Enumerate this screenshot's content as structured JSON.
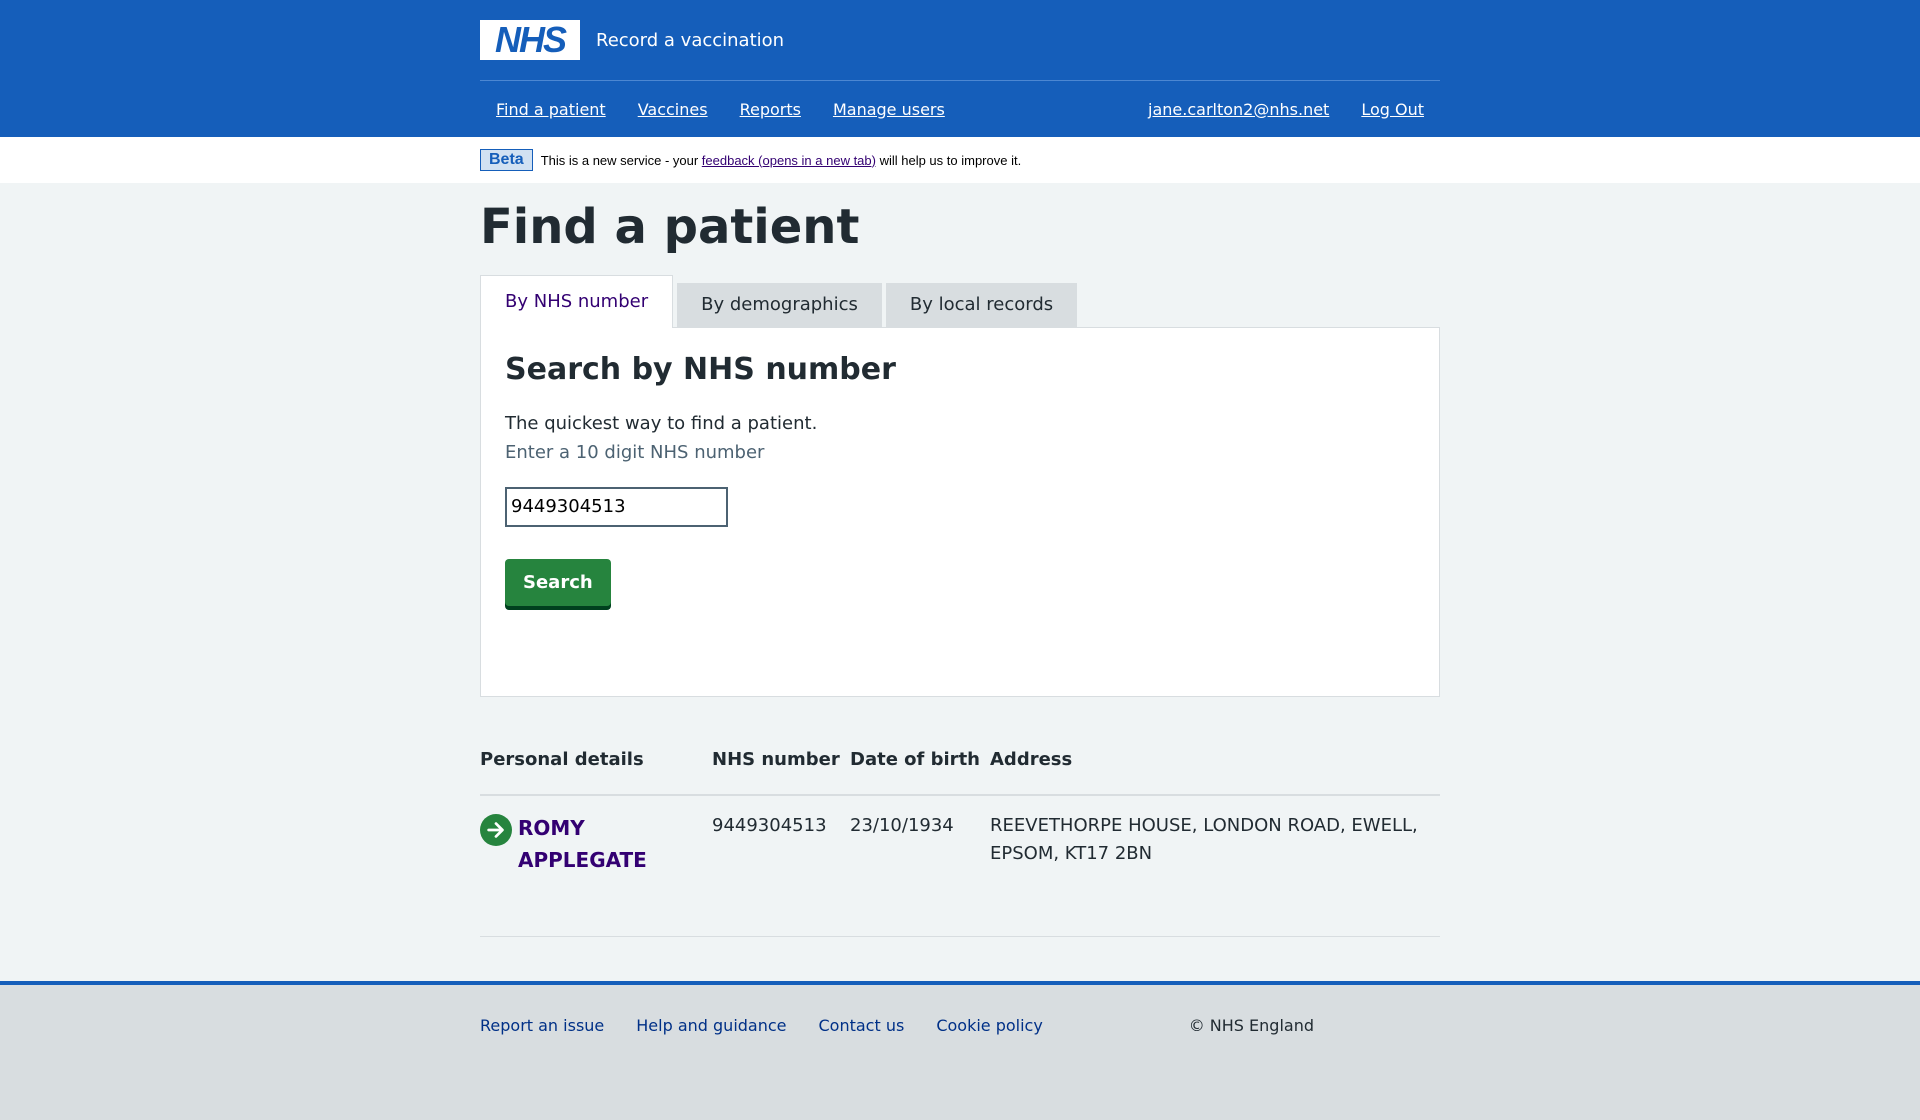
{
  "header": {
    "logo": "NHS",
    "service_name": "Record a vaccination",
    "nav": [
      "Find a patient",
      "Vaccines",
      "Reports",
      "Manage users"
    ],
    "user_email": "jane.carlton2@nhs.net",
    "logout": "Log Out"
  },
  "beta": {
    "tag": "Beta",
    "text_before": "This is a new service - your ",
    "link": "feedback (opens in a new tab)",
    "text_after": " will help us to improve it."
  },
  "page_title": "Find a patient",
  "tabs": [
    {
      "label": "By NHS number",
      "active": true
    },
    {
      "label": "By demographics",
      "active": false
    },
    {
      "label": "By local records",
      "active": false
    }
  ],
  "panel": {
    "heading": "Search by NHS number",
    "intro": "The quickest way to find a patient.",
    "hint": "Enter a 10 digit NHS number",
    "input_value": "9449304513",
    "search_button": "Search"
  },
  "results": {
    "columns": [
      "Personal details",
      "NHS number",
      "Date of birth",
      "Address"
    ],
    "rows": [
      {
        "first_name": "ROMY",
        "last_name": "APPLEGATE",
        "nhs_number": "9449304513",
        "dob": "23/10/1934",
        "address_line1": "REEVETHORPE HOUSE, LONDON ROAD, EWELL,",
        "address_line2": "EPSOM, KT17 2BN"
      }
    ]
  },
  "footer": {
    "links": [
      "Report an issue",
      "Help and guidance",
      "Contact us",
      "Cookie policy"
    ],
    "copyright": "© NHS England"
  },
  "colors": {
    "brand_blue": "#155eba",
    "success_green": "#26843e",
    "link_visited": "#330072"
  }
}
